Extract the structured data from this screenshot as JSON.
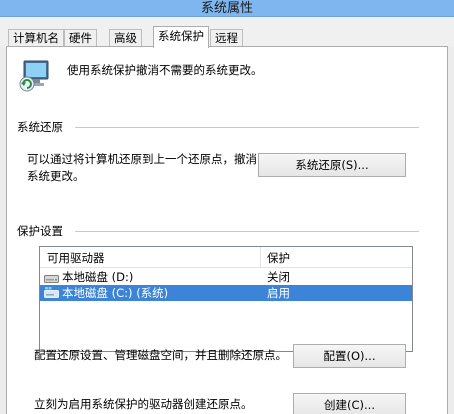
{
  "window": {
    "title": "系统属性"
  },
  "tabs": [
    {
      "label": "计算机名"
    },
    {
      "label": "硬件"
    },
    {
      "label": "高级"
    },
    {
      "label": "系统保护"
    },
    {
      "label": "远程"
    }
  ],
  "intro": {
    "text": "使用系统保护撤消不需要的系统更改。"
  },
  "restore": {
    "heading": "系统还原",
    "description": "可以通过将计算机还原到上一个还原点，撤消系统更改。",
    "button": "系统还原(S)..."
  },
  "protection": {
    "heading": "保护设置",
    "columns": [
      "可用驱动器",
      "保护"
    ],
    "rows": [
      {
        "drive": "本地磁盘 (D:)",
        "status": "关闭",
        "selected": false
      },
      {
        "drive": "本地磁盘 (C:) (系统)",
        "status": "启用",
        "selected": true
      }
    ],
    "configure_text": "配置还原设置、管理磁盘空间，并且删除还原点。",
    "configure_button": "配置(O)...",
    "create_text": "立刻为启用系统保护的驱动器创建还原点。",
    "create_button": "创建(C)..."
  }
}
